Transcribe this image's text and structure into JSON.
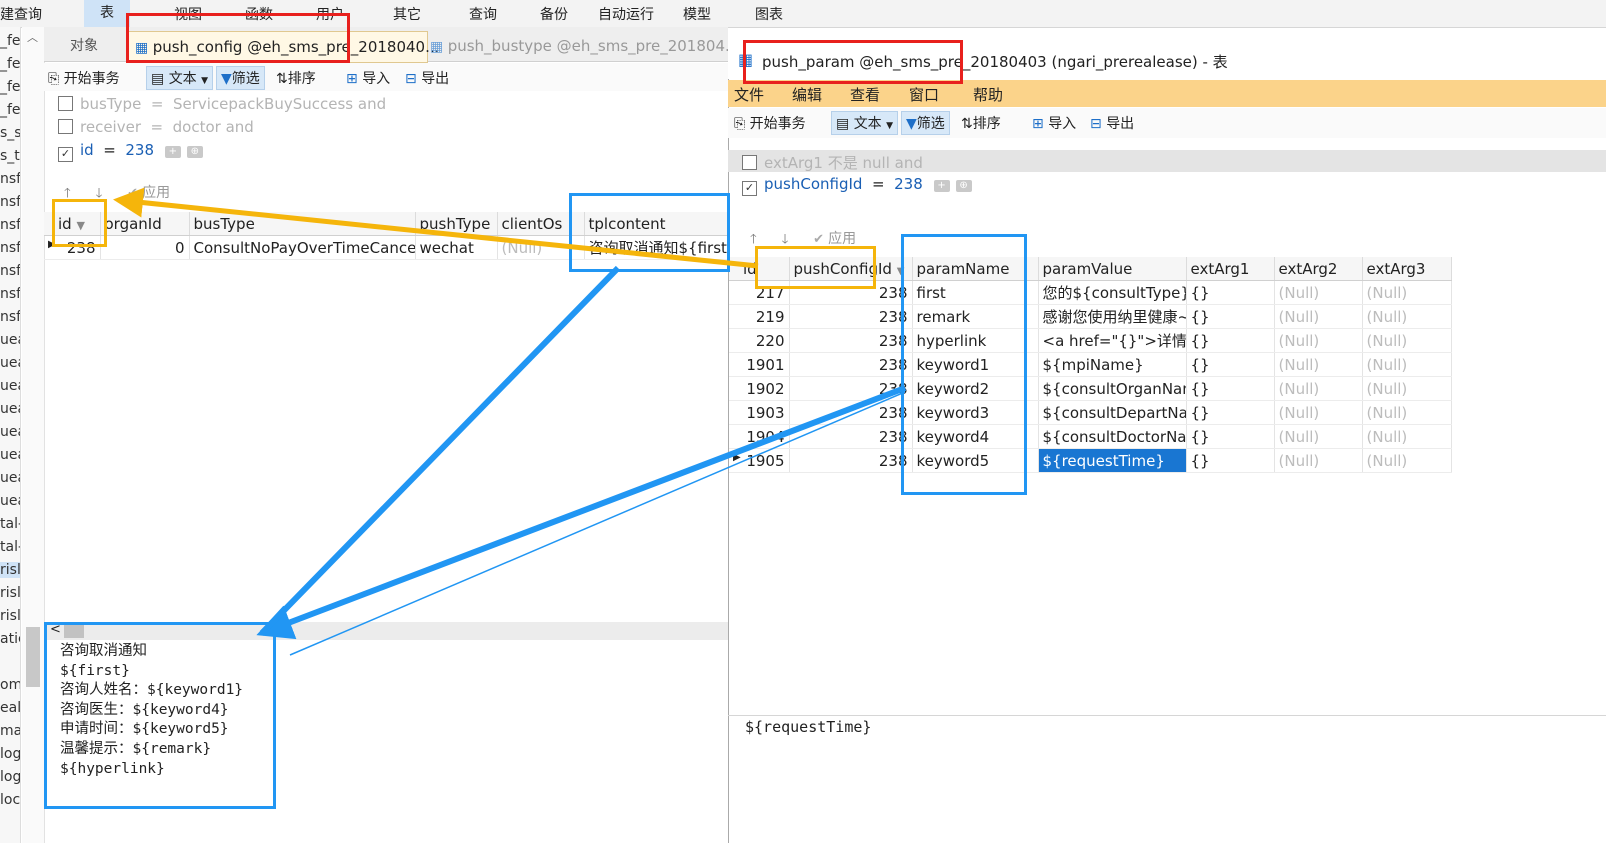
{
  "top_menu": {
    "items": [
      {
        "label": "建查询"
      },
      {
        "label": "表"
      },
      {
        "label": "视图"
      },
      {
        "label": "函数"
      },
      {
        "label": "用户"
      },
      {
        "label": "其它"
      },
      {
        "label": "查询"
      },
      {
        "label": "备份"
      },
      {
        "label": "自动运行"
      },
      {
        "label": "模型"
      },
      {
        "label": "图表"
      }
    ]
  },
  "left_strip": [
    "_fe",
    "_fe",
    "_fe",
    "_fe",
    "s_sh",
    "s_te",
    "nsfe",
    "nsfe",
    "nsfe",
    "nsfe",
    "nsfe",
    "nsfe",
    "nsfe",
    "uea",
    "uea",
    "uea",
    "uea",
    "uea",
    "uea",
    "uea",
    "uea",
    "tal-",
    "tal-",
    "risl",
    "risl",
    "risl",
    "atic",
    "om",
    "ealt",
    "mar",
    "log",
    "log",
    "loc"
  ],
  "left_panel": {
    "tabs": [
      {
        "label": "对象"
      },
      {
        "label": "push_config @eh_sms_pre_2018040..."
      },
      {
        "label": "push_bustype @eh_sms_pre_201804..."
      }
    ],
    "toolbar": {
      "begin_tx": "开始事务",
      "text": "文本",
      "filter": "筛选",
      "sort": "排序",
      "import": "导入",
      "export": "导出"
    },
    "filters": [
      {
        "field": "busType",
        "op": "=",
        "value": "ServicepackBuySuccess",
        "tail": "and",
        "checked": false
      },
      {
        "field": "receiver",
        "op": "=",
        "value": "doctor",
        "tail": "and",
        "checked": false
      },
      {
        "field": "id",
        "op": "=",
        "value": "238",
        "tail": "",
        "checked": true
      }
    ],
    "apply_label": "应用",
    "grid": {
      "columns": [
        "id",
        "organId",
        "busType",
        "pushType",
        "clientOs",
        "tplcontent"
      ],
      "rows": [
        {
          "id": "238",
          "organId": "0",
          "busType": "ConsultNoPayOverTimeCancel",
          "pushType": "wechat",
          "clientOs": "(Null)",
          "tplcontent": "咨询取消通知${first}咨"
        }
      ]
    },
    "memo": "咨询取消通知\n${first}\n咨询人姓名：${keyword1}\n咨询医生：${keyword4}\n申请时间：${keyword5}\n温馨提示：${remark}\n${hyperlink}"
  },
  "right_window": {
    "title": "push_param @eh_sms_pre_20180403 (ngari_prerealease) - 表",
    "menu": [
      {
        "label": "文件"
      },
      {
        "label": "编辑"
      },
      {
        "label": "查看"
      },
      {
        "label": "窗口"
      },
      {
        "label": "帮助"
      }
    ],
    "toolbar": {
      "begin_tx": "开始事务",
      "text": "文本",
      "filter": "筛选",
      "sort": "排序",
      "import": "导入",
      "export": "导出"
    },
    "filters": [
      {
        "field": "extArg1",
        "op": "不是",
        "value": "null",
        "tail": "and",
        "checked": false
      },
      {
        "field": "pushConfigId",
        "op": "=",
        "value": "238",
        "tail": "",
        "checked": true
      }
    ],
    "apply_label": "应用",
    "grid": {
      "columns": [
        "id",
        "pushConfigId",
        "paramName",
        "paramValue",
        "extArg1",
        "extArg2",
        "extArg3"
      ],
      "rows": [
        {
          "id": "217",
          "pushConfigId": "238",
          "paramName": "first",
          "paramValue": "您的${consultType}已",
          "extArg1": "{}",
          "extArg2": "(Null)",
          "extArg3": "(Null)"
        },
        {
          "id": "219",
          "pushConfigId": "238",
          "paramName": "remark",
          "paramValue": "感谢您使用纳里健康~",
          "extArg1": "{}",
          "extArg2": "(Null)",
          "extArg3": "(Null)"
        },
        {
          "id": "220",
          "pushConfigId": "238",
          "paramName": "hyperlink",
          "paramValue": "<a href=\"{}\">详情</a",
          "extArg1": "{}",
          "extArg2": "(Null)",
          "extArg3": "(Null)"
        },
        {
          "id": "1901",
          "pushConfigId": "238",
          "paramName": "keyword1",
          "paramValue": "${mpiName}",
          "extArg1": "{}",
          "extArg2": "(Null)",
          "extArg3": "(Null)"
        },
        {
          "id": "1902",
          "pushConfigId": "238",
          "paramName": "keyword2",
          "paramValue": "${consultOrganName",
          "extArg1": "{}",
          "extArg2": "(Null)",
          "extArg3": "(Null)"
        },
        {
          "id": "1903",
          "pushConfigId": "238",
          "paramName": "keyword3",
          "paramValue": "${consultDepartName",
          "extArg1": "{}",
          "extArg2": "(Null)",
          "extArg3": "(Null)"
        },
        {
          "id": "1904",
          "pushConfigId": "238",
          "paramName": "keyword4",
          "paramValue": "${consultDoctorName",
          "extArg1": "{}",
          "extArg2": "(Null)",
          "extArg3": "(Null)"
        },
        {
          "id": "1905",
          "pushConfigId": "238",
          "paramName": "keyword5",
          "paramValue": "${requestTime}",
          "extArg1": "{}",
          "extArg2": "(Null)",
          "extArg3": "(Null)"
        }
      ]
    },
    "memo": "${requestTime}"
  },
  "colors": {
    "menu_orange": "#fbd38a",
    "annot_red": "#e8201d",
    "annot_orange": "#f5b50b",
    "annot_blue": "#2196f3",
    "selection": "#1976d2"
  }
}
